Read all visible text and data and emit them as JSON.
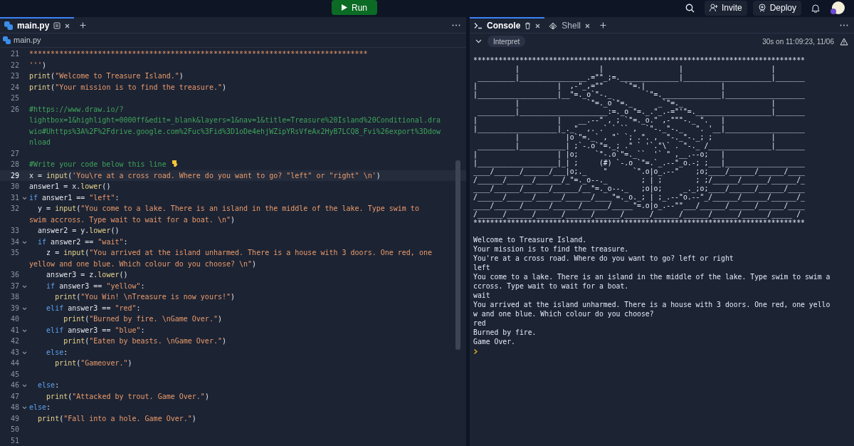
{
  "topbar": {
    "run_button": "Run",
    "invite_button": "Invite",
    "deploy_button": "Deploy"
  },
  "editor": {
    "tabs": [
      {
        "label": "main.py",
        "kind": "file",
        "selected": true
      }
    ],
    "breadcrumb": "main.py",
    "lines": [
      {
        "number": "21",
        "fold": false,
        "current": false,
        "tokens": [
          {
            "kind": "str",
            "text": "*******************************************************************************"
          }
        ]
      },
      {
        "number": "22",
        "fold": false,
        "current": false,
        "tokens": [
          {
            "kind": "str",
            "text": "'''"
          },
          {
            "kind": "plain",
            "text": ")"
          }
        ]
      },
      {
        "number": "23",
        "fold": false,
        "current": false,
        "tokens": [
          {
            "kind": "fn",
            "text": "print"
          },
          {
            "kind": "plain",
            "text": "("
          },
          {
            "kind": "str",
            "text": "\"Welcome to Treasure Island.\""
          },
          {
            "kind": "plain",
            "text": ")"
          }
        ]
      },
      {
        "number": "24",
        "fold": false,
        "current": false,
        "tokens": [
          {
            "kind": "fn",
            "text": "print"
          },
          {
            "kind": "plain",
            "text": "("
          },
          {
            "kind": "str",
            "text": "\"Your mission is to find the treasure.\""
          },
          {
            "kind": "plain",
            "text": ")"
          }
        ]
      },
      {
        "number": "25",
        "fold": false,
        "current": false
      },
      {
        "number": "26",
        "fold": false,
        "current": false,
        "tokens": [
          {
            "kind": "com",
            "text": "#https://www.draw.io/?lightbox=1&highlight=0000ff&edit=_blank&layers=1&nav=1&title=Treasure%20Island%20Conditional.drawio#Uhttps%3A%2F%2Fdrive.google.com%2Fuc%3Fid%3D1oDe4ehjWZipYRsVfeAx2HyB7LCQ8_Fvi%26export%3Ddownload"
          }
        ]
      },
      {
        "number": "27",
        "fold": false,
        "current": false
      },
      {
        "number": "28",
        "fold": false,
        "current": false,
        "tokens": [
          {
            "kind": "com",
            "text": "#Write your code below this line "
          },
          {
            "kind": "hand"
          }
        ]
      },
      {
        "number": "29",
        "fold": false,
        "current": true,
        "tokens": [
          {
            "kind": "plain",
            "text": "x = "
          },
          {
            "kind": "fn",
            "text": "input"
          },
          {
            "kind": "plain",
            "text": "("
          },
          {
            "kind": "str",
            "text": "'You\\re at a cross road. Where do you want to go? \"left\" or \"right\" \\n'"
          },
          {
            "kind": "plain",
            "text": ")"
          }
        ]
      },
      {
        "number": "30",
        "fold": false,
        "current": false,
        "tokens": [
          {
            "kind": "plain",
            "text": "answer1 = x."
          },
          {
            "kind": "fn",
            "text": "lower"
          },
          {
            "kind": "plain",
            "text": "()"
          }
        ]
      },
      {
        "number": "31",
        "fold": true,
        "current": false,
        "tokens": [
          {
            "kind": "kw",
            "text": "if"
          },
          {
            "kind": "plain",
            "text": " answer1 == "
          },
          {
            "kind": "str",
            "text": "\"left\""
          },
          {
            "kind": "plain",
            "text": ":"
          }
        ]
      },
      {
        "number": "32",
        "fold": false,
        "current": false,
        "tokens": [
          {
            "kind": "plain",
            "text": "  y = "
          },
          {
            "kind": "fn",
            "text": "input"
          },
          {
            "kind": "plain",
            "text": "("
          },
          {
            "kind": "str",
            "text": "\"You come to a lake. There is an island in the middle of the lake. Type swim to swim accross. Type wait to wait for a boat. \\n\""
          },
          {
            "kind": "plain",
            "text": ")"
          }
        ]
      },
      {
        "number": "33",
        "fold": false,
        "current": false,
        "tokens": [
          {
            "kind": "plain",
            "text": "  answer2 = y."
          },
          {
            "kind": "fn",
            "text": "lower"
          },
          {
            "kind": "plain",
            "text": "()"
          }
        ]
      },
      {
        "number": "34",
        "fold": true,
        "current": false,
        "tokens": [
          {
            "kind": "kw",
            "text": "  if"
          },
          {
            "kind": "plain",
            "text": " answer2 == "
          },
          {
            "kind": "str",
            "text": "\"wait\""
          },
          {
            "kind": "plain",
            "text": ":"
          }
        ]
      },
      {
        "number": "35",
        "fold": false,
        "current": false,
        "tokens": [
          {
            "kind": "plain",
            "text": "    z = "
          },
          {
            "kind": "fn",
            "text": "input"
          },
          {
            "kind": "plain",
            "text": "("
          },
          {
            "kind": "str",
            "text": "\"You arrived at the island unharmed. There is a house with 3 doors. One red, one yellow and one blue. Which colour do you choose? \\n\""
          },
          {
            "kind": "plain",
            "text": ")"
          }
        ]
      },
      {
        "number": "36",
        "fold": false,
        "current": false,
        "tokens": [
          {
            "kind": "plain",
            "text": "    answer3 = z."
          },
          {
            "kind": "fn",
            "text": "lower"
          },
          {
            "kind": "plain",
            "text": "()"
          }
        ]
      },
      {
        "number": "37",
        "fold": true,
        "current": false,
        "tokens": [
          {
            "kind": "kw",
            "text": "    if"
          },
          {
            "kind": "plain",
            "text": " answer3 == "
          },
          {
            "kind": "str",
            "text": "\"yellow\""
          },
          {
            "kind": "plain",
            "text": ":"
          }
        ]
      },
      {
        "number": "38",
        "fold": false,
        "current": false,
        "tokens": [
          {
            "kind": "fn",
            "text": "      print"
          },
          {
            "kind": "plain",
            "text": "("
          },
          {
            "kind": "str",
            "text": "\"You Win! \\nTreasure is now yours!\""
          },
          {
            "kind": "plain",
            "text": ")"
          }
        ]
      },
      {
        "number": "39",
        "fold": true,
        "current": false,
        "tokens": [
          {
            "kind": "kw",
            "text": "    elif"
          },
          {
            "kind": "plain",
            "text": " answer3 == "
          },
          {
            "kind": "str",
            "text": "\"red\""
          },
          {
            "kind": "plain",
            "text": ":"
          }
        ]
      },
      {
        "number": "40",
        "fold": false,
        "current": false,
        "tokens": [
          {
            "kind": "fn",
            "text": "        print"
          },
          {
            "kind": "plain",
            "text": "("
          },
          {
            "kind": "str",
            "text": "\"Burned by fire. \\nGame Over.\""
          },
          {
            "kind": "plain",
            "text": ")"
          }
        ]
      },
      {
        "number": "41",
        "fold": true,
        "current": false,
        "tokens": [
          {
            "kind": "kw",
            "text": "    elif"
          },
          {
            "kind": "plain",
            "text": " answer3 == "
          },
          {
            "kind": "str",
            "text": "\"blue\""
          },
          {
            "kind": "plain",
            "text": ":"
          }
        ]
      },
      {
        "number": "42",
        "fold": false,
        "current": false,
        "tokens": [
          {
            "kind": "fn",
            "text": "        print"
          },
          {
            "kind": "plain",
            "text": "("
          },
          {
            "kind": "str",
            "text": "\"Eaten by beasts. \\nGame Over.\""
          },
          {
            "kind": "plain",
            "text": ")"
          }
        ]
      },
      {
        "number": "43",
        "fold": true,
        "current": false,
        "tokens": [
          {
            "kind": "kw",
            "text": "    else"
          },
          {
            "kind": "plain",
            "text": ":"
          }
        ]
      },
      {
        "number": "44",
        "fold": false,
        "current": false,
        "tokens": [
          {
            "kind": "fn",
            "text": "      print"
          },
          {
            "kind": "plain",
            "text": "("
          },
          {
            "kind": "str",
            "text": "\"Gameover.\""
          },
          {
            "kind": "plain",
            "text": ")"
          }
        ]
      },
      {
        "number": "45",
        "fold": false,
        "current": false
      },
      {
        "number": "46",
        "fold": true,
        "current": false,
        "tokens": [
          {
            "kind": "kw",
            "text": "  else"
          },
          {
            "kind": "plain",
            "text": ":"
          }
        ]
      },
      {
        "number": "47",
        "fold": false,
        "current": false,
        "tokens": [
          {
            "kind": "fn",
            "text": "    print"
          },
          {
            "kind": "plain",
            "text": "("
          },
          {
            "kind": "str",
            "text": "\"Attacked by trout. Game Over.\""
          },
          {
            "kind": "plain",
            "text": ")"
          }
        ]
      },
      {
        "number": "48",
        "fold": true,
        "current": false,
        "tokens": [
          {
            "kind": "kw",
            "text": "else"
          },
          {
            "kind": "plain",
            "text": ":"
          }
        ]
      },
      {
        "number": "49",
        "fold": false,
        "current": false,
        "tokens": [
          {
            "kind": "fn",
            "text": "  print"
          },
          {
            "kind": "plain",
            "text": "("
          },
          {
            "kind": "str",
            "text": "\"Fall into a hole. Game Over.\""
          },
          {
            "kind": "plain",
            "text": ")"
          }
        ]
      },
      {
        "number": "50",
        "fold": false,
        "current": false
      },
      {
        "number": "51",
        "fold": false,
        "current": false
      }
    ]
  },
  "console": {
    "tabs": [
      {
        "label": "Console",
        "kind": "console",
        "selected": true
      },
      {
        "label": "Shell",
        "kind": "shell",
        "selected": false
      }
    ],
    "mode": "Interpret",
    "run_info": "30s on 11:09:23, 11/06",
    "art": [
      "*******************************************************************************",
      "          |                   |                  |                     |",
      " _________|________________.=\"\"_;=.______________|_____________________|_______",
      "|                   |  ,-\"_,=\"\"     `\"=.|                  |",
      "|___________________|__\"=._o`\"-._        `\"=.______________|___________________",
      "          |                `\"=._o`\"=._      _`\"=._                     |",
      " _________|_____________________:=._o \"=._.\"_.-=\"'\"=.__________________|_______",
      "|                   |    __.--\" , ; `\"=._o.\" ,-\"\"\"-._ \".   |",
      "|___________________|_._\"  ,. .` ` `` ,  `\"-._\"-._   \". '__|___________________",
      "          |           |o`\"=._` , \"` `; .\". ,  \"-._\"-._; ;              |",
      " _________|___________| ;`-.o`\"=._; .\" ` '`.\"\\` . \"-._ /_______________|_______",
      "|                   | |o;    `\"-.o`\"=._``  '` \" ,__.--o;   |",
      "|___________________|_| ;     (#) `-.o `\"=.`_.--\"_o.-; ;___|___________________",
      "____/______/______/___|o;._    \"      `\".o|o_.--\"    ;o;____/______/______/____",
      "/______/______/______/_\"=._o--._        ; | ;        ; ;/______/______/______/_",
      "____/______/______/______/__\"=._o--._   ;o|o;     _._;o;____/______/______/____",
      "/______/______/______/______/____\"=._o._; | ;_.--\"o.--\"_/______/______/______/_",
      "____/______/______/______/______/_____\"=.o|o_.--\"\"___/______/______/______/____",
      "/______/______/______/______/______/______/______/______/______/______/_____ /",
      "*******************************************************************************"
    ],
    "output": [
      "Welcome to Treasure Island.",
      "Your mission is to find the treasure.",
      "You're at a cross road. Where do you want to go? left or right",
      "left",
      "You come to a lake. There is an island in the middle of the lake. Type swim to swim accross. Type wait to wait for a boat.",
      "wait",
      "You arrived at the island unharmed. There is a house with 3 doors. One red, one yellow and one blue. Which colour do you choose?",
      "red",
      "Burned by fire.",
      "Game Over."
    ]
  }
}
